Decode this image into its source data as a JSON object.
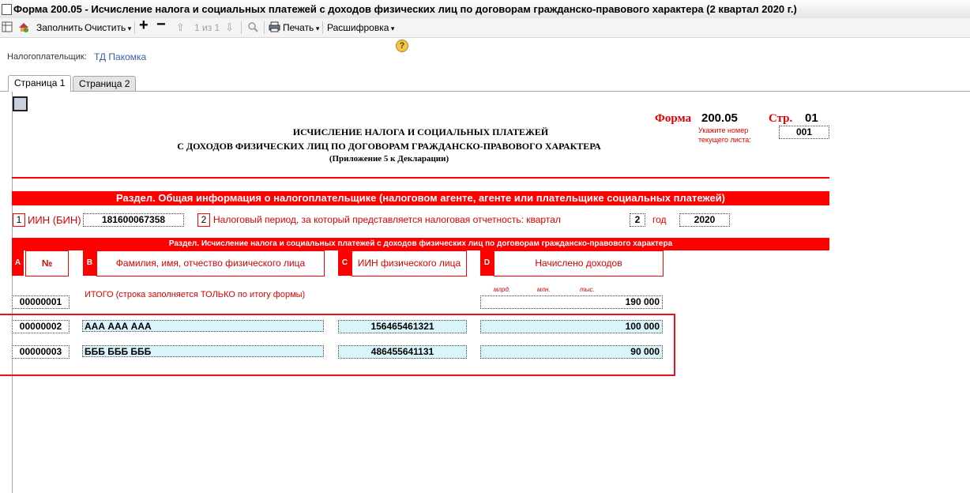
{
  "window": {
    "title": "Форма 200.05 - Исчисление налога и социальных платежей с доходов физических лиц по договорам гражданско-правового характера (2 квартал 2020 г.)"
  },
  "toolbar": {
    "fill": "Заполнить",
    "clear": "Очистить",
    "pager": "1 из 1",
    "print": "Печать",
    "decode": "Расшифровка",
    "help": "?"
  },
  "taxpayer": {
    "label": "Налогоплательщик:",
    "value": "ТД Пакомка"
  },
  "tabs": [
    {
      "label": "Страница 1"
    },
    {
      "label": "Страница 2"
    }
  ],
  "form": {
    "form_label": "Форма",
    "form_number": "200.05",
    "page_label": "Стр.",
    "page_number": "01",
    "sheet_hint_1": "Укажите номер",
    "sheet_hint_2": "текущего листа:",
    "sheet_number": "001",
    "title_1": "ИСЧИСЛЕНИЕ НАЛОГА И СОЦИАЛЬНЫХ ПЛАТЕЖЕЙ",
    "title_2": "С ДОХОДОВ ФИЗИЧЕСКИХ ЛИЦ ПО ДОГОВОРАМ ГРАЖДАНСКО-ПРАВОВОГО ХАРАКТЕРА",
    "title_3": "(Приложение 5 к Декларации)",
    "section1_title": "Раздел. Общая информация о налогоплательщике (налоговом агенте, агенте или плательщике социальных платежей)",
    "field1_num": "1",
    "field1_label": "ИИН (БИН)",
    "field1_value": "181600067358",
    "field2_num": "2",
    "field2_label": "Налоговый период, за который представляется налоговая отчетность: квартал",
    "field2_value": "2",
    "year_label": "год",
    "year_value": "2020",
    "section2_title": "Раздел. Исчисление налога и социальных платежей с доходов физических лиц по договорам гражданско-правового характера",
    "columns": [
      {
        "letter": "A",
        "label": "№"
      },
      {
        "letter": "B",
        "label": "Фамилия, имя, отчество физического лица"
      },
      {
        "letter": "C",
        "label": "ИИН физического лица"
      },
      {
        "letter": "D",
        "label": "Начислено доходов"
      }
    ],
    "units": {
      "bn": "млрд.",
      "mn": "млн.",
      "th": "тыс."
    },
    "total_row": {
      "num": "00000001",
      "label": "ИТОГО (строка заполняется ТОЛЬКО по итогу формы)",
      "amount": "190 000"
    },
    "rows": [
      {
        "num": "00000002",
        "name": "ААА ААА ААА",
        "iin": "156465461321",
        "amount": "100 000"
      },
      {
        "num": "00000003",
        "name": "БББ БББ БББ",
        "iin": "486455641131",
        "amount": "90 000"
      }
    ]
  },
  "colors": {
    "accent_red": "#ff0000",
    "field_fill": "#d9f5fb",
    "link": "#3c5ca8"
  }
}
